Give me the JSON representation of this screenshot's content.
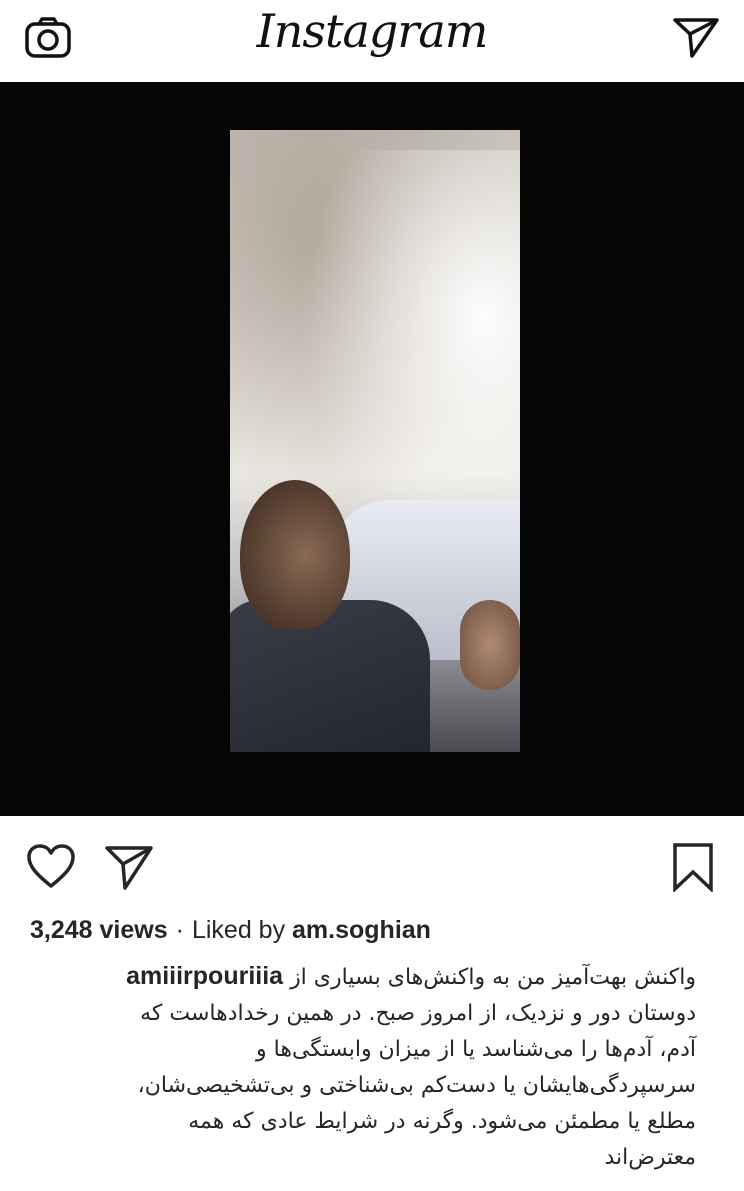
{
  "header": {
    "logo_text": "Instagram",
    "camera_icon": "camera-icon",
    "direct_icon": "paper-plane-icon"
  },
  "post": {
    "actions": {
      "like_icon": "heart-icon",
      "share_icon": "paper-plane-icon",
      "save_icon": "bookmark-icon"
    },
    "views": "3,248 views",
    "separator": "·",
    "liked_by_label": "Liked by",
    "liked_by_user": "am.soghian",
    "caption": {
      "author": "amiiirpouriiia",
      "line1_text": "واکنش بهت‌آمیز من به واکنش‌های بسیاری از",
      "line2": "دوستان دور و نزدیک، از امروز صبح. در همین رخدادهاست که",
      "line3": "آدم، آدم‌ها را می‌شناسد یا از میزان وابستگی‌ها و",
      "line4": "سرسپردگی‌هایشان یا دست‌کم بی‌شناختی و بی‌تشخیصی‌شان،",
      "line5": "مطلع یا مطمئن می‌شود. وگرنه در شرایط عادی که همه",
      "line6": "معترض‌اند"
    }
  },
  "colors": {
    "background": "#ffffff",
    "media_background": "#050505",
    "text": "#262626"
  }
}
